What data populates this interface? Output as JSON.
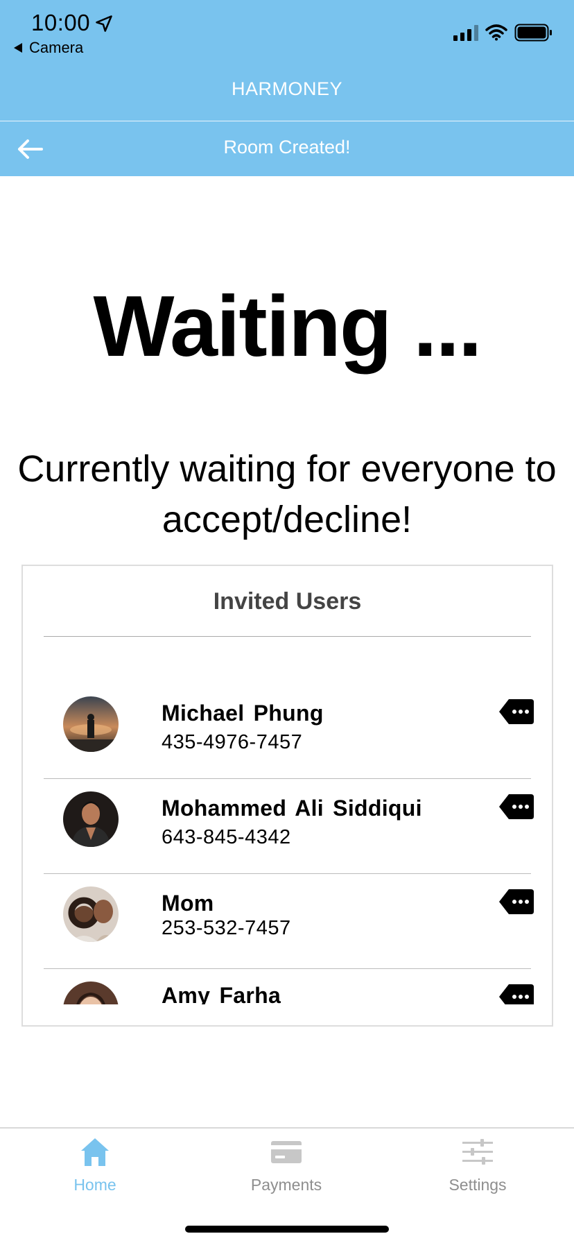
{
  "status_bar": {
    "time": "10:00",
    "back_app": "Camera"
  },
  "header": {
    "app_title": "HARMONEY",
    "nav_title": "Room Created!"
  },
  "main": {
    "heading": "Waiting ...",
    "subtitle": "Currently waiting for everyone to accept/decline!"
  },
  "invited": {
    "title": "Invited Users",
    "users": [
      {
        "name": "Michael Phung",
        "phone": "435-4976-7457"
      },
      {
        "name": "Mohammed Ali Siddiqui",
        "phone": "643-845-4342"
      },
      {
        "name": "Mom",
        "phone": "253-532-7457"
      },
      {
        "name": "Amy Farha",
        "phone": ""
      }
    ]
  },
  "tabs": [
    {
      "label": "Home",
      "icon": "home-icon",
      "active": true
    },
    {
      "label": "Payments",
      "icon": "credit-card-icon",
      "active": false
    },
    {
      "label": "Settings",
      "icon": "sliders-icon",
      "active": false
    }
  ],
  "colors": {
    "accent": "#79c3ee",
    "inactive_tab": "#8e8e8e"
  }
}
